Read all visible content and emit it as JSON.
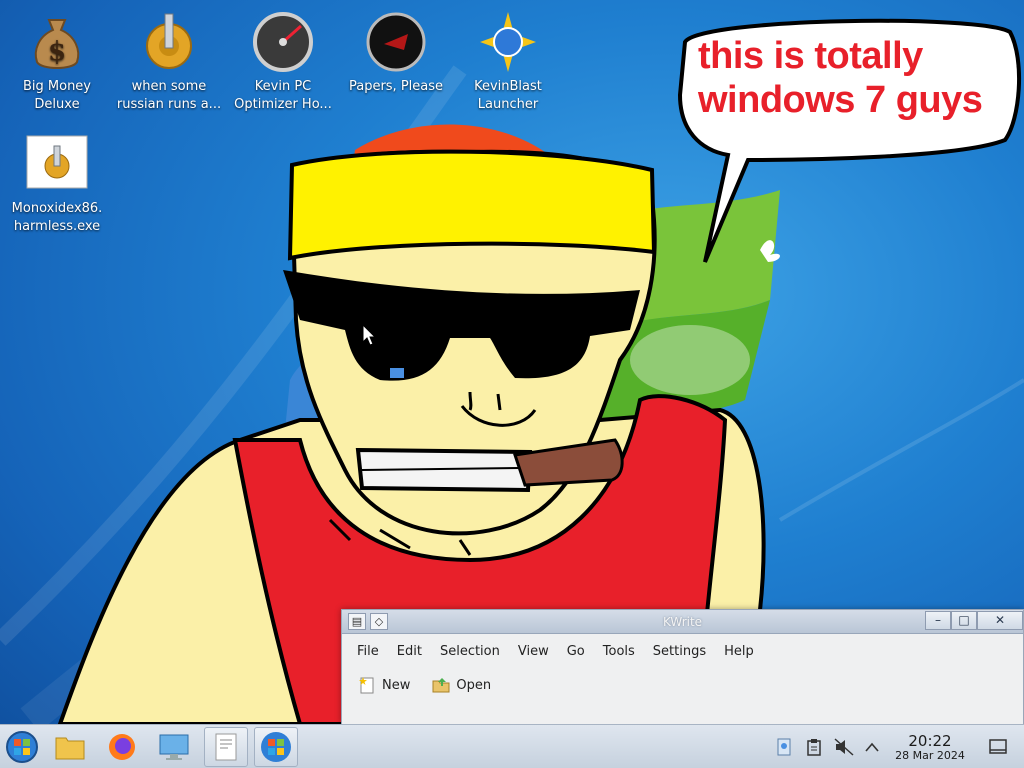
{
  "desktop": {
    "icons": [
      {
        "label": "Big Money Deluxe",
        "icon": "money-bag-icon"
      },
      {
        "label": "when some russian runs a...",
        "icon": "gear-icon"
      },
      {
        "label": "Kevin PC Optimizer Ho...",
        "icon": "speedometer-icon"
      },
      {
        "label": "Papers, Please",
        "icon": "papers-please-icon"
      },
      {
        "label": "KevinBlast Launcher",
        "icon": "kevinblast-icon"
      },
      {
        "label": "Monoxidex86.harmless.exe",
        "icon": "exe-gear-icon"
      }
    ],
    "icon_lines": {
      "big_money": [
        "Big Money",
        "Deluxe"
      ],
      "russian": [
        "when some",
        "russian runs a..."
      ],
      "kevin_pc": [
        "Kevin PC",
        "Optimizer Ho..."
      ],
      "papers": [
        "Papers, Please"
      ],
      "kevinblast": [
        "KevinBlast",
        "Launcher"
      ],
      "monoxidex": [
        "Monoxidex86.",
        "harmless.exe"
      ]
    },
    "speech_bubble": {
      "line1": "this is totally",
      "line2": "windows 7 guys",
      "color": "#e8202a"
    }
  },
  "kwrite": {
    "title": "KWrite",
    "menus": [
      "File",
      "Edit",
      "Selection",
      "View",
      "Go",
      "Tools",
      "Settings",
      "Help"
    ],
    "toolbar": {
      "new_label": "New",
      "open_label": "Open"
    }
  },
  "taskbar": {
    "pinned": [
      "start-orb-icon",
      "file-manager-icon",
      "firefox-icon",
      "system-settings-icon",
      "kwrite-icon",
      "windows-flag-icon"
    ],
    "clock": {
      "time": "20:22",
      "date": "28 Mar 2024"
    }
  }
}
